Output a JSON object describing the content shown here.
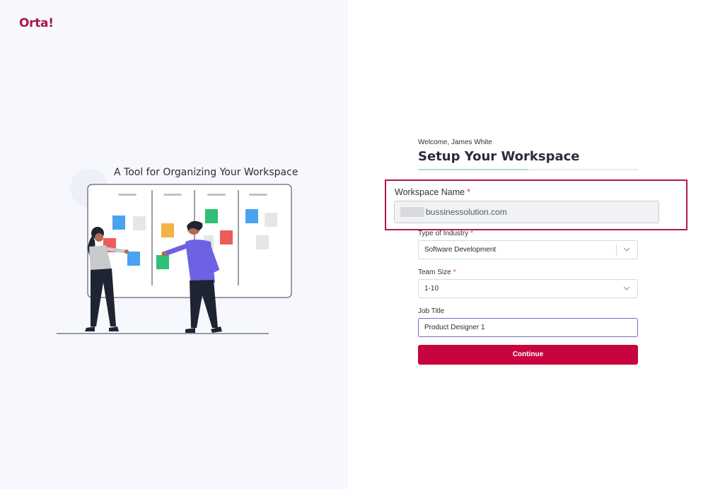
{
  "brand": {
    "logo_text": "Orta!",
    "logo_color": "#a8154f"
  },
  "left_panel": {
    "tagline": "A Tool for Organizing Your Workspace"
  },
  "header": {
    "welcome": "Welcome,  James White",
    "title": "Setup Your Workspace",
    "progress_fraction": 0.5
  },
  "form": {
    "workspace_name": {
      "label": "Workspace Name",
      "required_mark": "*",
      "value": "bussinessolution.com"
    },
    "industry": {
      "label": "Type of Industry",
      "required_mark": "*",
      "value": "Software Development"
    },
    "team_size": {
      "label": "Team Size",
      "required_mark": "*",
      "value": "1-10"
    },
    "job_title": {
      "label": "Job Title",
      "value": "Product Designer 1"
    },
    "continue_label": "Continue"
  },
  "colors": {
    "accent": "#c8043e",
    "highlight": "#b3184b",
    "focus": "#6c6fe0",
    "progress": "#b4dbd1"
  }
}
